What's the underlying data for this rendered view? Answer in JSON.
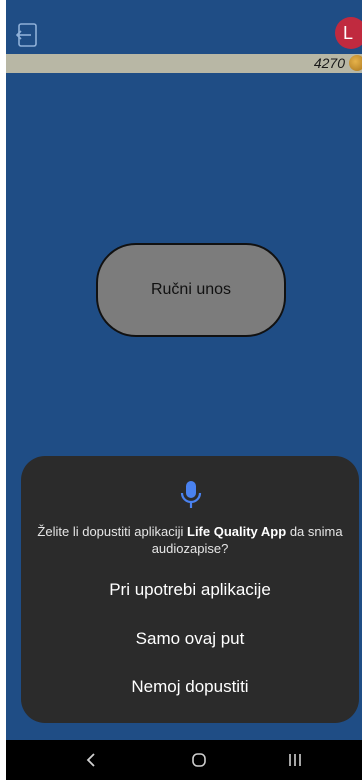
{
  "header": {
    "avatar_initial": "L",
    "points": "4270"
  },
  "main": {
    "manual_entry_label": "Ručni unos"
  },
  "permission_dialog": {
    "message_prefix": "Želite li dopustiti aplikaciji ",
    "app_name": "Life Quality App",
    "message_suffix": " da snima audiozapise?",
    "options": [
      "Pri upotrebi aplikacije",
      "Samo ovaj put",
      "Nemoj dopustiti"
    ]
  },
  "icons": {
    "logout": "logout-icon",
    "coin": "coin-icon",
    "microphone": "microphone-icon",
    "back": "back-icon",
    "home": "home-icon",
    "recents": "recents-icon"
  },
  "colors": {
    "background": "#1f4d85",
    "avatar": "#c02a3f",
    "dialog": "#2b2b2b",
    "accent_blue": "#4a82f0",
    "button_fill": "#7c7c7c"
  }
}
